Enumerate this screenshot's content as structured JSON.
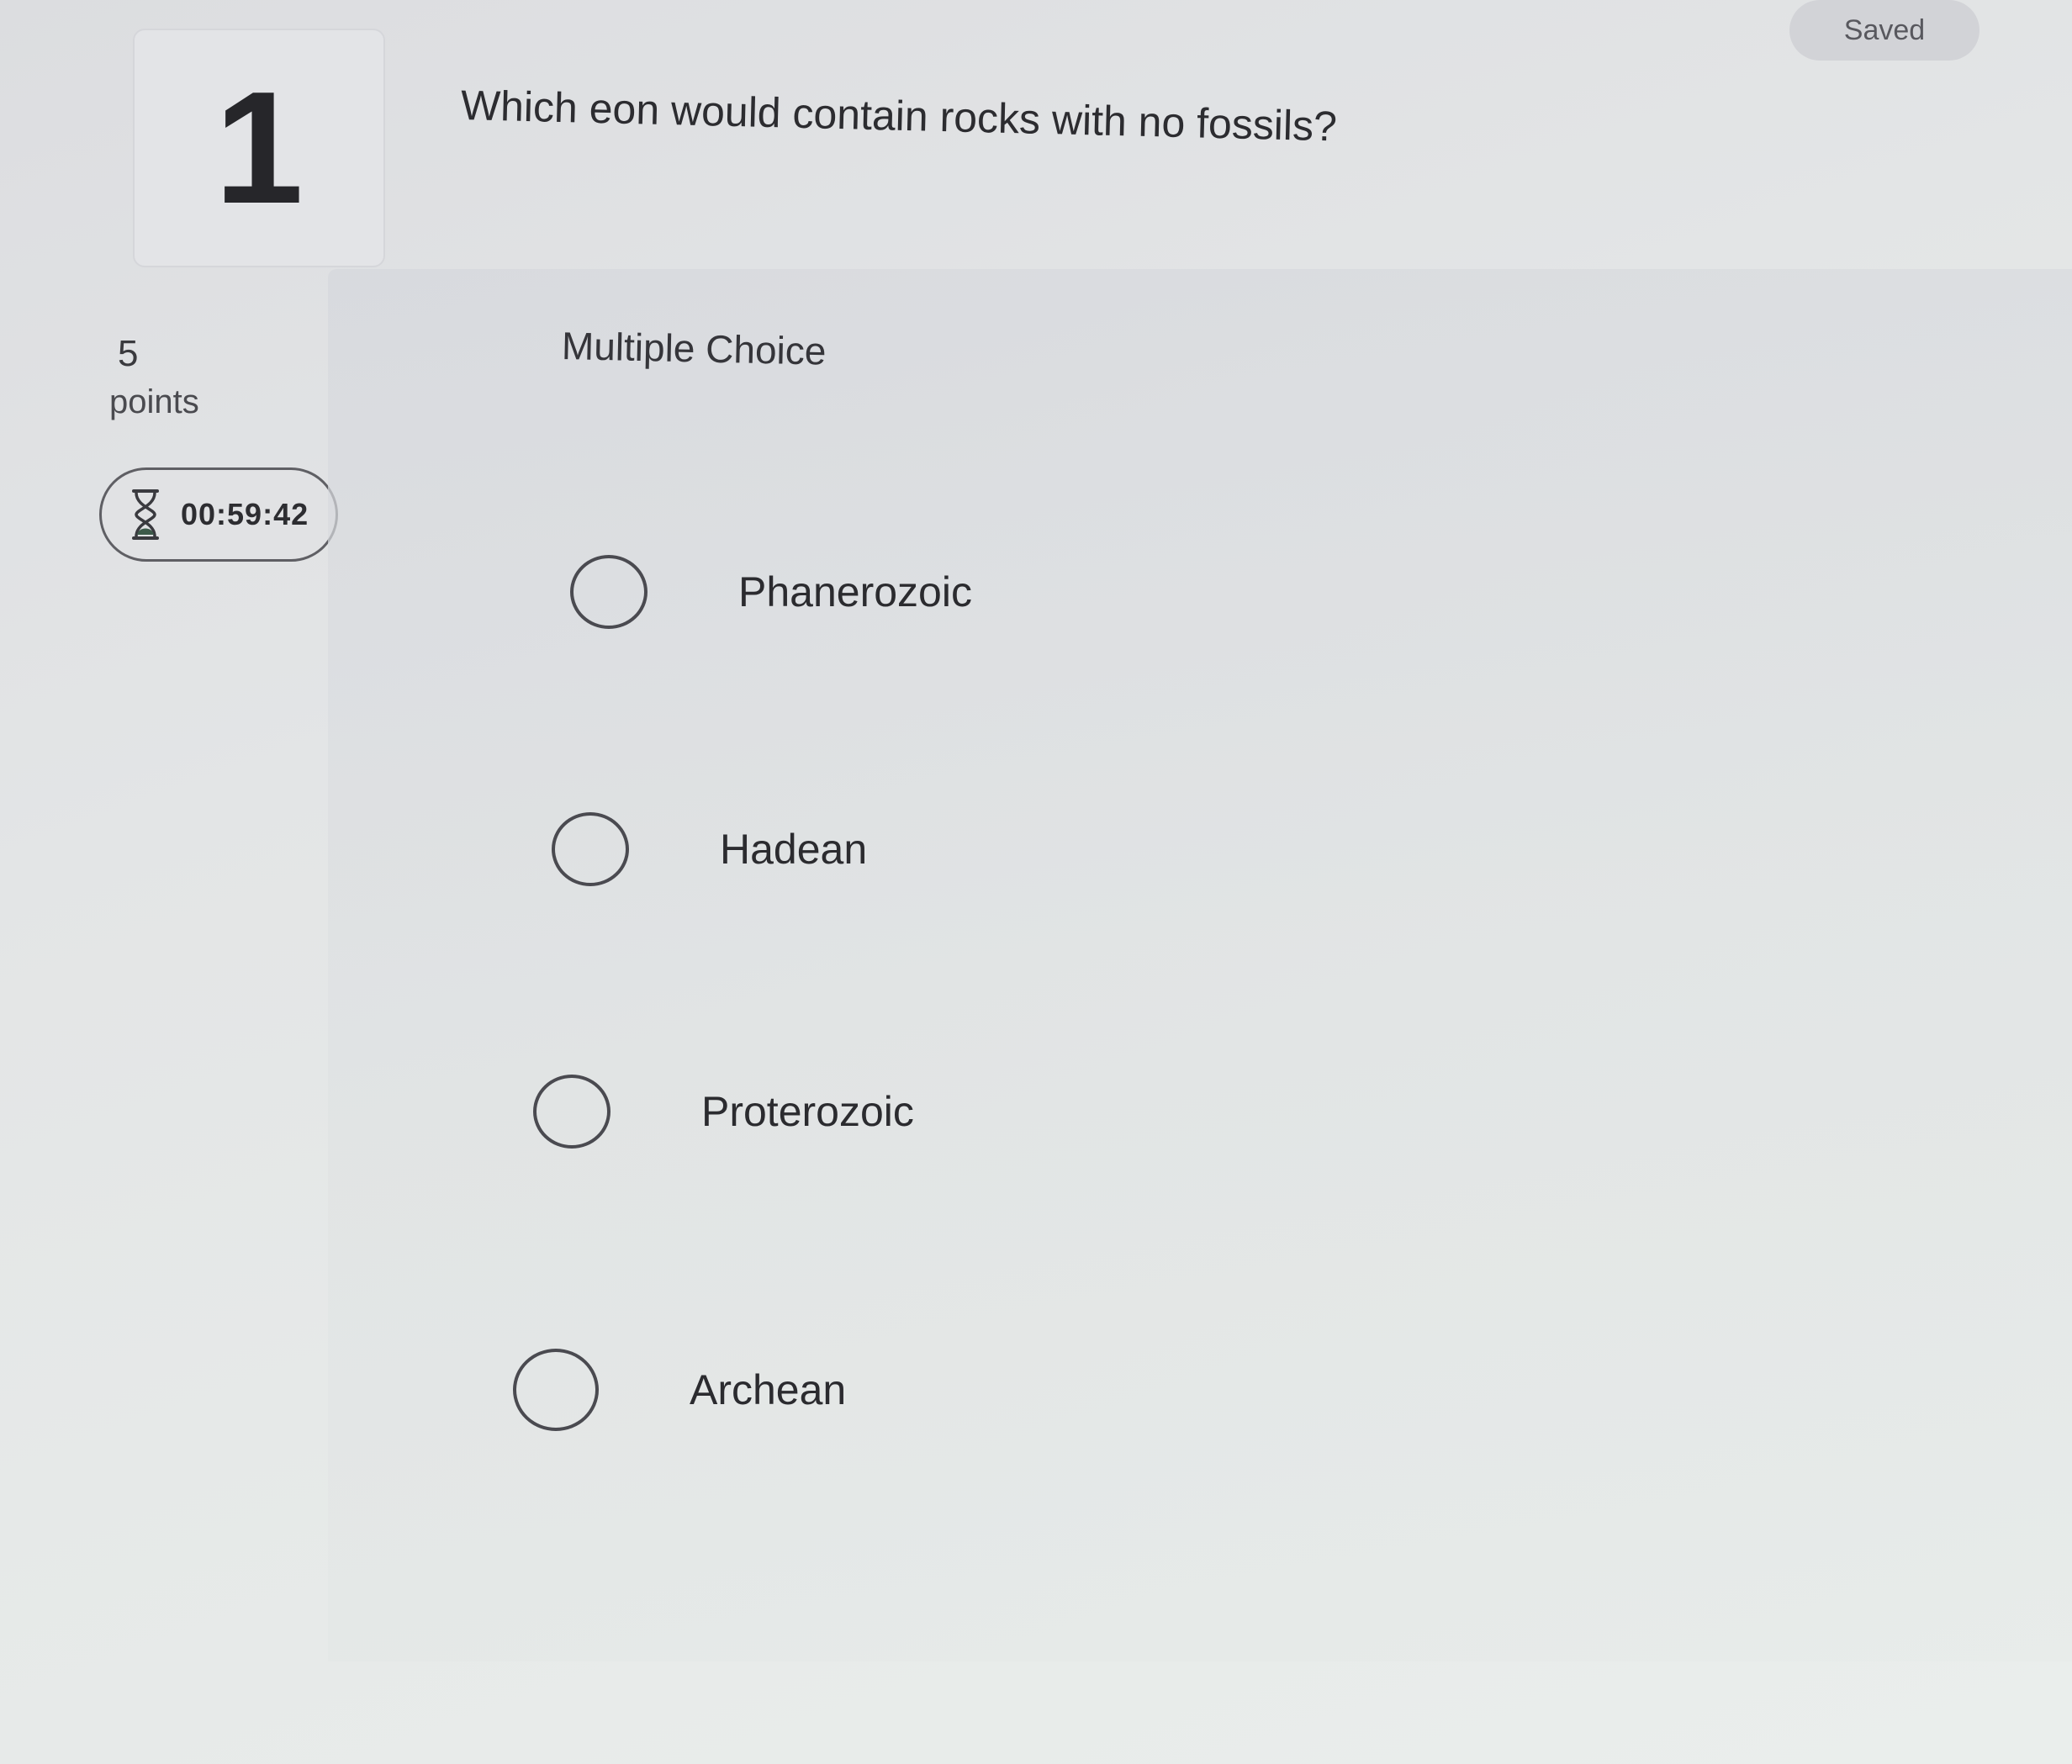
{
  "status": {
    "saved_label": "Saved"
  },
  "question": {
    "number": "1",
    "text": "Which eon would contain rocks with no fossils?",
    "type_label": "Multiple Choice",
    "points_value": "5",
    "points_label": "points"
  },
  "timer": {
    "icon": "hourglass-icon",
    "value": "00:59:42"
  },
  "options": [
    {
      "label": "Phanerozoic",
      "selected": false
    },
    {
      "label": "Hadean",
      "selected": false
    },
    {
      "label": "Proterozoic",
      "selected": false
    },
    {
      "label": "Archean",
      "selected": false
    }
  ],
  "colors": {
    "background": "#e3e5e6",
    "text": "#2b2b2e",
    "radio_border": "#4a4a50",
    "timer_icon": "#3d5a4a"
  }
}
